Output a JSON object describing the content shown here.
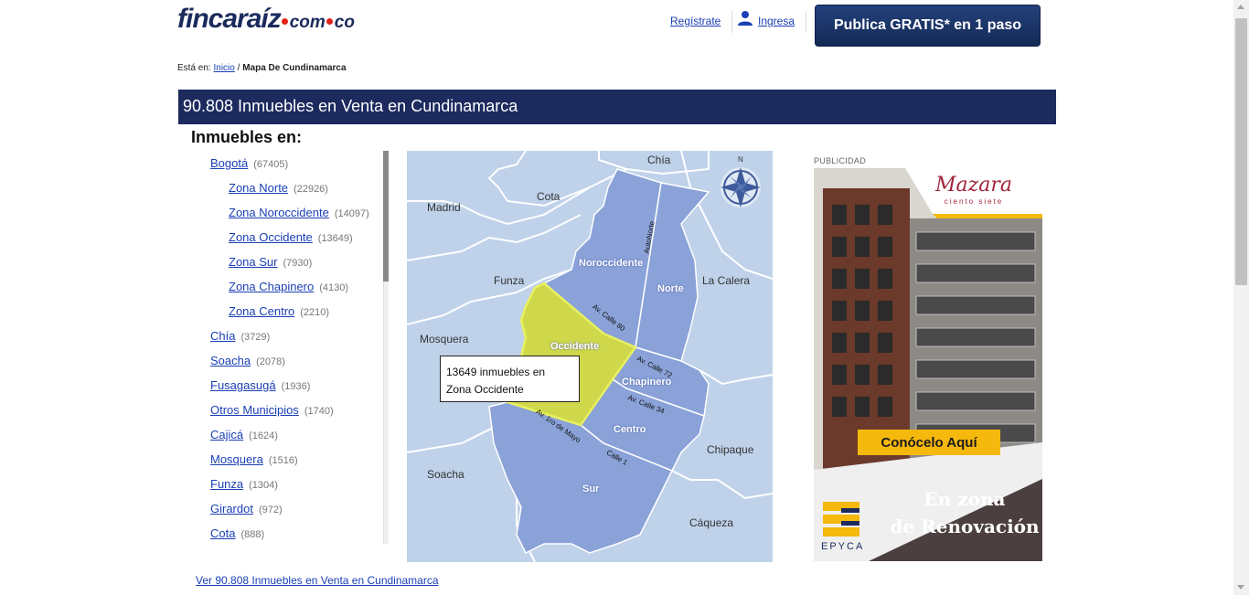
{
  "header": {
    "logo_main": "fincaraíz",
    "logo_com": "com",
    "logo_co": "co",
    "register_label": "Regístrate",
    "login_label": "Ingresa",
    "publish_label": "Publica GRATIS* en 1 paso"
  },
  "breadcrumb": {
    "prefix": "Está en:",
    "home": "Inicio",
    "separator": "/",
    "current": "Mapa De Cundinamarca"
  },
  "title": "90.808 Inmuebles en Venta en Cundinamarca",
  "subheading": "Inmuebles en:",
  "locations": [
    {
      "name": "Bogotá",
      "count": "(67405)"
    },
    {
      "name": "Zona Norte",
      "count": "(22926)"
    },
    {
      "name": "Zona Noroccidente",
      "count": "(14097)"
    },
    {
      "name": "Zona Occidente",
      "count": "(13649)"
    },
    {
      "name": "Zona Sur",
      "count": "(7930)"
    },
    {
      "name": "Zona Chapinero",
      "count": "(4130)"
    },
    {
      "name": "Zona Centro",
      "count": "(2210)"
    },
    {
      "name": "Chía",
      "count": "(3729)"
    },
    {
      "name": "Soacha",
      "count": "(2078)"
    },
    {
      "name": "Fusagasugá",
      "count": "(1936)"
    },
    {
      "name": "Otros Municipios",
      "count": "(1740)"
    },
    {
      "name": "Cajicá",
      "count": "(1624)"
    },
    {
      "name": "Mosquera",
      "count": "(1516)"
    },
    {
      "name": "Funza",
      "count": "(1304)"
    },
    {
      "name": "Girardot",
      "count": "(972)"
    },
    {
      "name": "Cota",
      "count": "(888)"
    }
  ],
  "map": {
    "compass": "N",
    "municipalities": {
      "chia": "Chía",
      "cota": "Cota",
      "madrid": "Madrid",
      "funza": "Funza",
      "la_calera": "La Calera",
      "mosquera": "Mosquera",
      "chipaque": "Chipaque",
      "soacha": "Soacha",
      "caqueza": "Cáqueza"
    },
    "zones": {
      "noroccidente": "Noroccidente",
      "norte": "Norte",
      "occidente": "Occidente",
      "chapinero": "Chapinero",
      "centro": "Centro",
      "sur": "Sur"
    },
    "streets": {
      "autonorte": "AutoNorte",
      "calle80": "Av. Calle 80",
      "calle72": "Av. Calle 72",
      "calle34": "Av. Calle 34",
      "primero_mayo": "Av. 1ro de Mayo",
      "calle1": "Calle 1"
    },
    "tooltip_line1": "13649 inmuebles en",
    "tooltip_line2": "Zona Occidente",
    "highlight_color": "#cfd84a",
    "zone_color": "#8aa2d8"
  },
  "ad": {
    "label": "PUBLICIDAD",
    "brand": "Mazara",
    "brand_sub": "ciento siete",
    "cta": "Conócelo Aquí",
    "line1": "En zona",
    "line2": "de Renovación",
    "company": "EPYCA"
  },
  "footer_link": "Ver 90.808 Inmuebles en Venta en Cundinamarca"
}
